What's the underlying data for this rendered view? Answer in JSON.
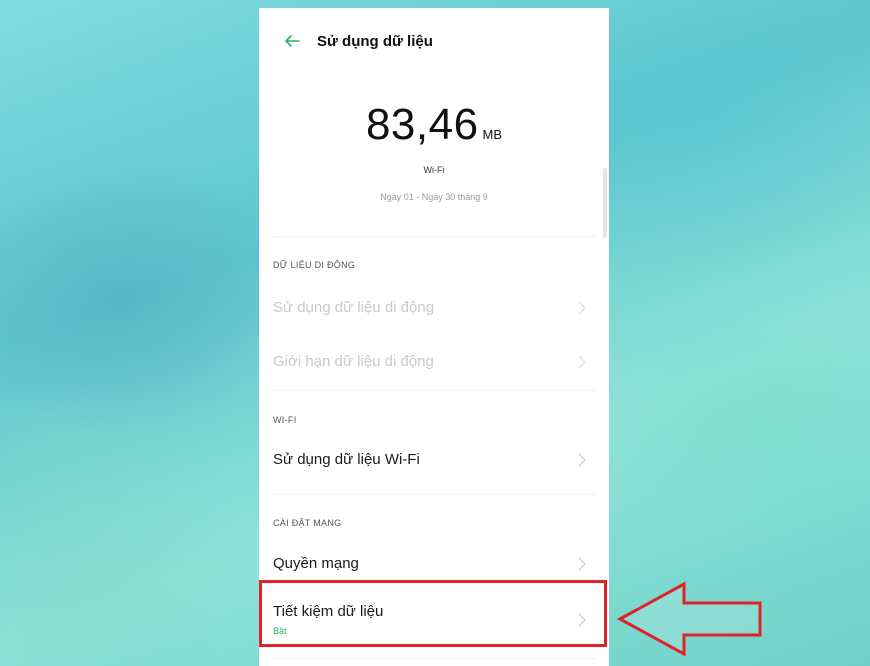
{
  "header": {
    "title": "Sử dụng dữ liệu",
    "back_icon": "arrow-left-icon"
  },
  "usage": {
    "amount": "83,46",
    "unit": "MB",
    "connection": "Wi-Fi",
    "period": "Ngày 01 - Ngày 30 tháng 9"
  },
  "mobile_section": {
    "header": "DỮ LIỆU DI ĐỘNG",
    "items": [
      {
        "label": "Sử dụng dữ liệu di động"
      },
      {
        "label": "Giới hạn dữ liệu di động"
      }
    ]
  },
  "wifi_section": {
    "header": "WI-FI",
    "items": [
      {
        "label": "Sử dụng dữ liệu Wi-Fi"
      }
    ]
  },
  "network_section": {
    "header": "CÀI ĐẶT MẠNG",
    "items": [
      {
        "label": "Quyền mạng"
      },
      {
        "label": "Tiết kiệm dữ liệu",
        "status": "Bật"
      }
    ]
  },
  "colors": {
    "accent": "#2ab35a",
    "highlight": "#e0232a"
  }
}
